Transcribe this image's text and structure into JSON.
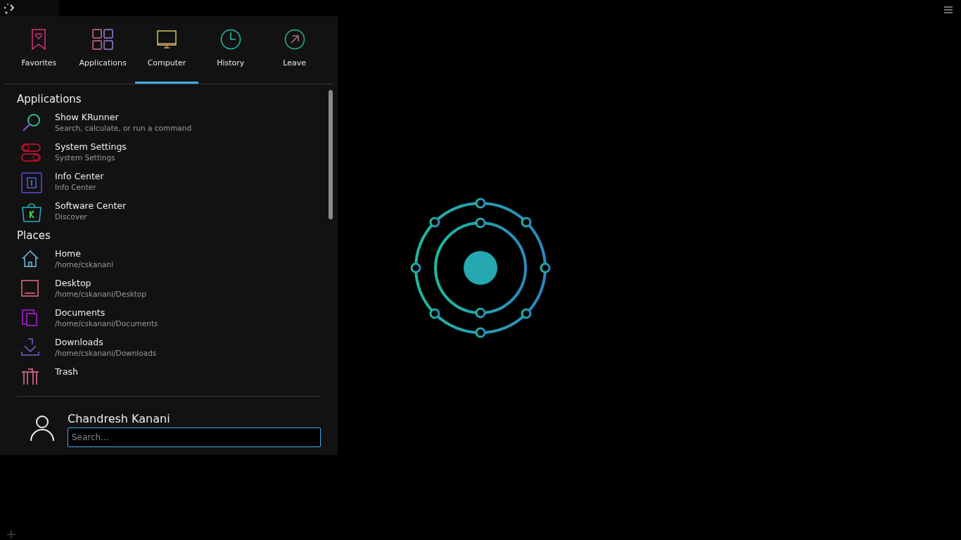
{
  "tabs": [
    {
      "label": "Favorites",
      "selected": false
    },
    {
      "label": "Applications",
      "selected": false
    },
    {
      "label": "Computer",
      "selected": true
    },
    {
      "label": "History",
      "selected": false
    },
    {
      "label": "Leave",
      "selected": false
    }
  ],
  "sections": [
    {
      "title": "Applications",
      "items": [
        {
          "title": "Show KRunner",
          "subtitle": "Search, calculate, or run a command"
        },
        {
          "title": "System Settings",
          "subtitle": "System Settings"
        },
        {
          "title": "Info Center",
          "subtitle": "Info Center"
        },
        {
          "title": "Software Center",
          "subtitle": "Discover"
        }
      ]
    },
    {
      "title": "Places",
      "items": [
        {
          "title": "Home",
          "subtitle": "/home/cskanani"
        },
        {
          "title": "Desktop",
          "subtitle": "/home/cskanani/Desktop"
        },
        {
          "title": "Documents",
          "subtitle": "/home/cskanani/Documents"
        },
        {
          "title": "Downloads",
          "subtitle": "/home/cskanani/Downloads"
        },
        {
          "title": "Trash"
        }
      ]
    }
  ],
  "user": {
    "name": "Chandresh Kanani"
  },
  "search": {
    "placeholder": "Search..."
  }
}
